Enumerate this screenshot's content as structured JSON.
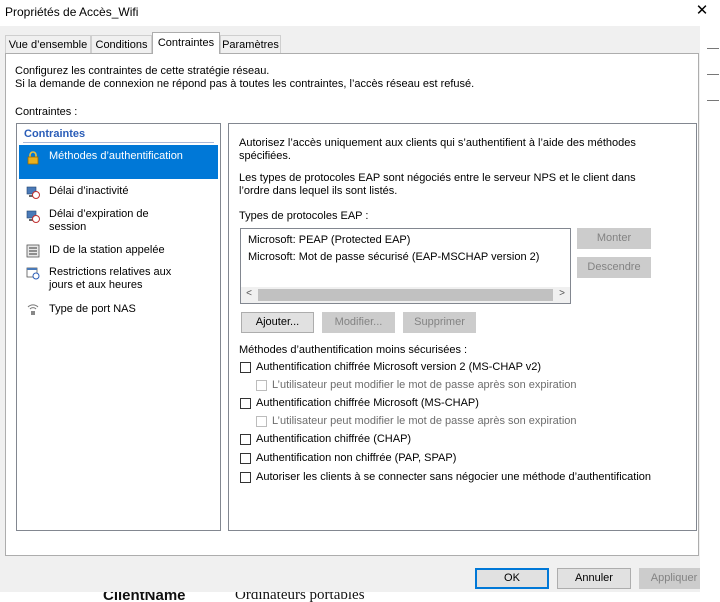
{
  "window": {
    "title": "Propriétés de Accès_Wifi",
    "close_glyph": "✕"
  },
  "tabs": [
    {
      "label": "Vue d’ensemble"
    },
    {
      "label": "Conditions"
    },
    {
      "label": "Contraintes",
      "active": true
    },
    {
      "label": "Paramètres"
    }
  ],
  "intro": {
    "line1": "Configurez les contraintes de cette stratégie réseau.",
    "line2": "Si la demande de connexion ne répond pas à toutes les contraintes, l’accès réseau est refusé."
  },
  "constraints_label": "Contraintes :",
  "left_list": {
    "header": "Contraintes",
    "items": [
      {
        "label1": "Méthodes d’authentification",
        "label2": "",
        "icon": "lock-icon",
        "selected": true
      },
      {
        "label1": "Délai d’inactivité",
        "label2": "",
        "icon": "computer-clock-icon"
      },
      {
        "label1": "Délai d’expiration de",
        "label2": "session",
        "icon": "computer-clock-icon"
      },
      {
        "label1": "ID de la station appelée",
        "label2": "",
        "icon": "station-list-icon"
      },
      {
        "label1": "Restrictions relatives aux",
        "label2": "jours et aux heures",
        "icon": "calendar-clock-icon"
      },
      {
        "label1": "Type de port NAS",
        "label2": "",
        "icon": "network-port-icon"
      }
    ]
  },
  "right": {
    "p1_line1": "Autorisez l’accès uniquement aux clients qui s’authentifient à l’aide des méthodes",
    "p1_line2": "spécifiées.",
    "p2_line1": "Les types de protocoles EAP sont négociés entre le serveur NPS et le client dans",
    "p2_line2": "l’ordre dans lequel ils sont listés.",
    "eap_label": "Types de protocoles EAP :",
    "eap_items": [
      "Microsoft: PEAP (Protected EAP)",
      "Microsoft: Mot de passe sécurisé (EAP-MSCHAP version 2)"
    ],
    "buttons": {
      "up": "Monter",
      "down": "Descendre",
      "add": "Ajouter...",
      "edit": "Modifier...",
      "remove": "Supprimer"
    },
    "less_secure_label": "Méthodes d’authentification moins sécurisées :",
    "checkboxes": [
      {
        "label": "Authentification chiffrée Microsoft version 2 (MS-CHAP v2)",
        "checked": false
      },
      {
        "label": "L’utilisateur peut modifier le mot de passe après son expiration",
        "checked": false,
        "disabled": true
      },
      {
        "label": "Authentification chiffrée Microsoft (MS-CHAP)",
        "checked": false
      },
      {
        "label": "L’utilisateur peut modifier le mot de passe après son expiration",
        "checked": false,
        "disabled": true
      },
      {
        "label": "Authentification chiffrée (CHAP)",
        "checked": false
      },
      {
        "label": "Authentification non chiffrée (PAP, SPAP)",
        "checked": false
      },
      {
        "label": "Autoriser les clients à se connecter sans négocier une méthode d’authentification",
        "checked": false
      }
    ]
  },
  "footer": {
    "ok": "OK",
    "cancel": "Annuler",
    "apply": "Appliquer"
  },
  "background_text": {
    "left": "ClientName",
    "right": "Ordinateurs portables"
  },
  "colors": {
    "selection": "#0078d7",
    "list_header": "#2a5db8",
    "dialog_bg": "#f0f0f0"
  }
}
